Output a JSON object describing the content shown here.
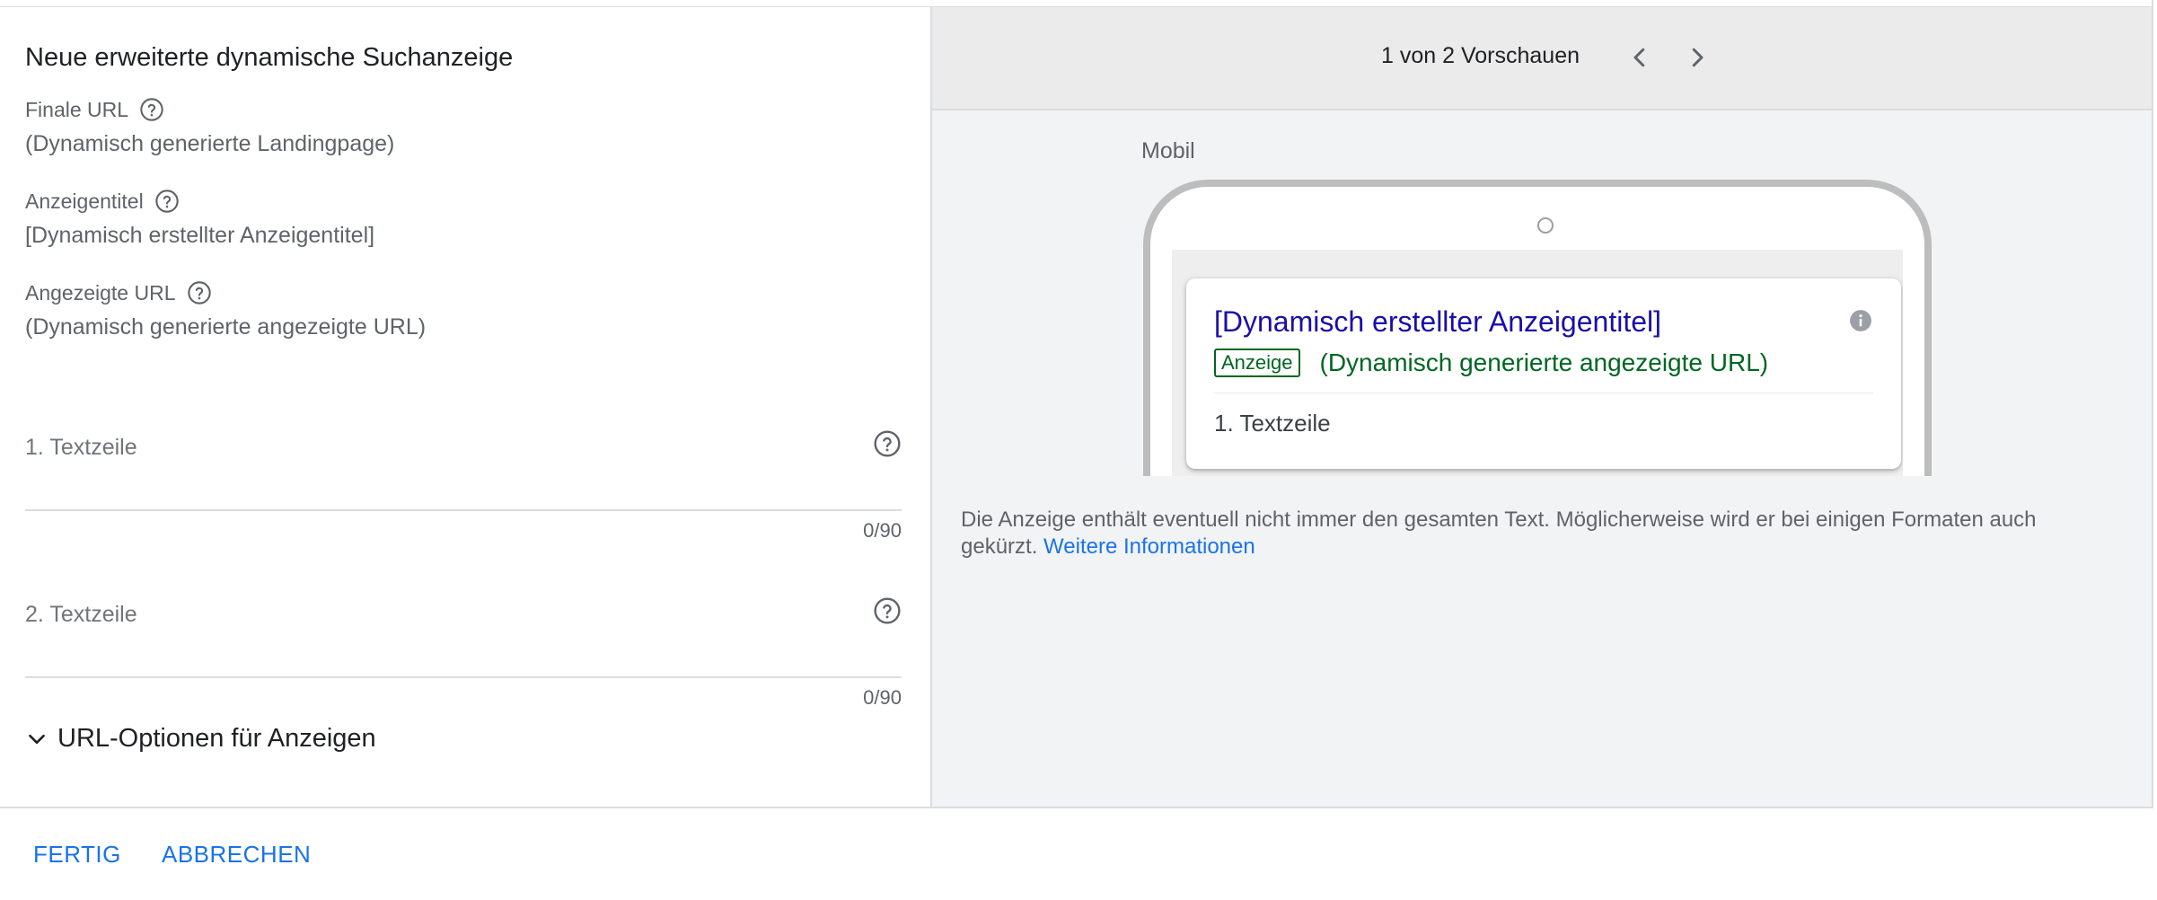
{
  "editor": {
    "title": "Neue erweiterte dynamische Suchanzeige",
    "final_url": {
      "label": "Finale URL",
      "value": "(Dynamisch generierte Landingpage)"
    },
    "headline": {
      "label": "Anzeigentitel",
      "value": "[Dynamisch erstellter Anzeigentitel]"
    },
    "display_url": {
      "label": "Angezeigte URL",
      "value": "(Dynamisch generierte angezeigte URL)"
    },
    "line1": {
      "label": "1. Textzeile",
      "value": "",
      "counter": "0/90"
    },
    "line2": {
      "label": "2. Textzeile",
      "value": "",
      "counter": "0/90"
    },
    "url_options": "URL-Optionen für Anzeigen"
  },
  "preview": {
    "count": "1 von 2 Vorschauen",
    "device": "Mobil",
    "ad": {
      "title": "[Dynamisch erstellter Anzeigentitel]",
      "badge": "Anzeige",
      "url": "(Dynamisch generierte angezeigte URL)",
      "text": "1. Textzeile"
    },
    "notice": "Die Anzeige enthält eventuell nicht immer den gesamten Text. Möglicherweise wird er bei einigen Formaten auch gekürzt.",
    "notice_link": "Weitere Informationen"
  },
  "footer": {
    "done": "FERTIG",
    "cancel": "ABBRECHEN"
  },
  "colors": {
    "accent": "#1a73e8",
    "ad_title": "#1a0dab",
    "ad_url": "#006621"
  },
  "icons": {
    "help": "help-circle-icon",
    "prev": "chevron-left-icon",
    "next": "chevron-right-icon",
    "expand": "chevron-down-icon",
    "info": "info-icon",
    "camera": "camera-dot-icon"
  }
}
